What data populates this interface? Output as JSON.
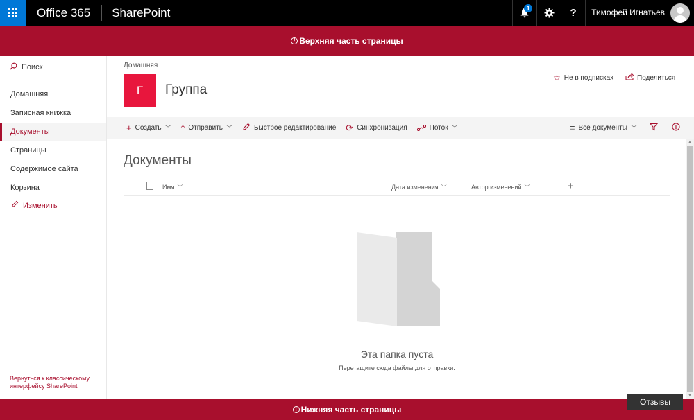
{
  "suitebar": {
    "brand": "Office 365",
    "app_name": "SharePoint",
    "notification_count": "1",
    "help_label": "?",
    "user_name": "Тимофей Игнатьев"
  },
  "banners": {
    "top": "Верхняя часть страницы",
    "bottom": "Нижняя часть страницы"
  },
  "leftnav": {
    "search_label": "Поиск",
    "items": [
      {
        "label": "Домашняя"
      },
      {
        "label": "Записная книжка"
      },
      {
        "label": "Документы"
      },
      {
        "label": "Страницы"
      },
      {
        "label": "Содержимое сайта"
      },
      {
        "label": "Корзина"
      }
    ],
    "edit_label": "Изменить",
    "classic_link": "Вернуться к классическому интерфейсу SharePoint"
  },
  "header": {
    "breadcrumb": "Домашняя",
    "site_tile_letter": "Г",
    "site_title": "Группа",
    "follow_label": "Не в подписках",
    "share_label": "Поделиться"
  },
  "commandbar": {
    "create": "Создать",
    "upload": "Отправить",
    "quick_edit": "Быстрое редактирование",
    "sync": "Синхронизация",
    "flow": "Поток",
    "view": "Все документы"
  },
  "main": {
    "heading": "Документы",
    "columns": {
      "name": "Имя",
      "modified": "Дата изменения",
      "modified_by": "Автор изменений"
    },
    "empty_title": "Эта папка пуста",
    "empty_subtitle": "Перетащите сюда файлы для отправки."
  },
  "feedback_label": "Отзывы",
  "colors": {
    "accent": "#a80f2d",
    "tile": "#e8163d",
    "waffle": "#0078d7"
  }
}
